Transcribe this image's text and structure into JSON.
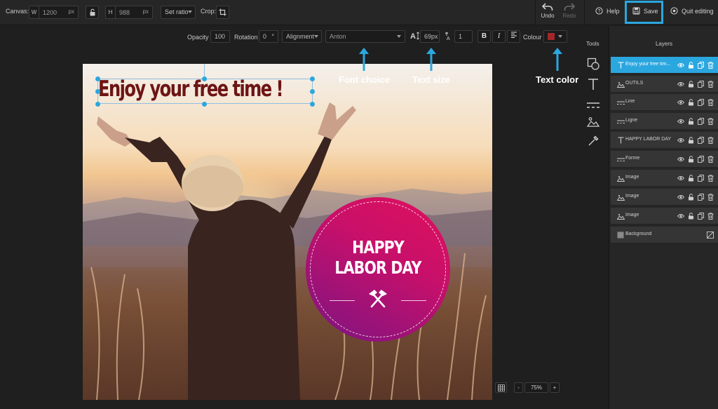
{
  "topbar": {
    "canvas_label": "Canvas:",
    "width_prefix": "W",
    "width_value": "1200",
    "width_unit": "px",
    "height_prefix": "H",
    "height_value": "988",
    "height_unit": "px",
    "ratio_label": "Set ratio",
    "crop_label": "Crop:",
    "undo_label": "Undo",
    "redo_label": "Redo",
    "help_label": "Help",
    "save_label": "Save",
    "quit_label": "Quit editing"
  },
  "text_toolbar": {
    "opacity_label": "Opacity",
    "opacity_value": "100",
    "rotation_label": "Rotation",
    "rotation_value": "0",
    "rotation_unit": "°",
    "alignment_label": "Alignment",
    "font_value": "Anton",
    "size_value": "69px",
    "spacing_value": "1",
    "bold_label": "B",
    "italic_label": "I",
    "colour_label": "Colour",
    "colour_value": "#a3262a"
  },
  "tools": {
    "title": "Tools",
    "items": [
      "shapes-icon",
      "text-icon",
      "line-icon",
      "image-icon",
      "eyedropper-icon"
    ]
  },
  "layers": {
    "title": "Layers",
    "items": [
      {
        "name": "Enjoy your free tim...",
        "type": "text",
        "active": true
      },
      {
        "name": "OUTILS",
        "type": "image",
        "active": false
      },
      {
        "name": "Line",
        "type": "line",
        "active": false
      },
      {
        "name": "Ligne",
        "type": "line",
        "active": false
      },
      {
        "name": "HAPPY LABOR DAY",
        "type": "text",
        "active": false
      },
      {
        "name": "Forme",
        "type": "line",
        "active": false
      },
      {
        "name": "Image",
        "type": "image",
        "active": false
      },
      {
        "name": "Image",
        "type": "image",
        "active": false
      },
      {
        "name": "Image",
        "type": "image",
        "active": false
      },
      {
        "name": "Background",
        "type": "background",
        "active": false
      }
    ]
  },
  "canvas": {
    "headline": "Enjoy your free time !",
    "badge_line1": "HAPPY",
    "badge_line2": "LABOR DAY"
  },
  "annotations": {
    "font_choice": "Font choice",
    "text_size": "Text size",
    "text_color": "Text color"
  },
  "zoom": {
    "minus": "-",
    "value": "75%",
    "plus": "+"
  },
  "colors": {
    "accent": "#2ba7df",
    "headline": "#6d1414",
    "badge_top": "#e0105c",
    "badge_bottom": "#7a1482"
  }
}
